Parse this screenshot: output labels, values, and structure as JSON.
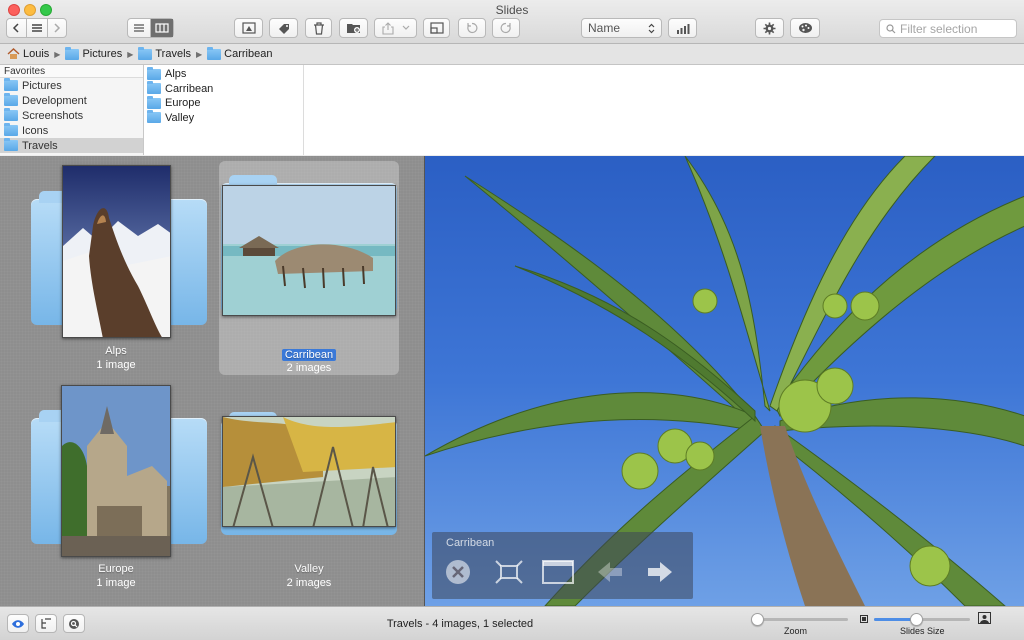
{
  "window": {
    "title": "Slides"
  },
  "toolbar": {
    "sort_value": "Name",
    "filter_placeholder": "Filter selection"
  },
  "path": [
    {
      "label": "Louis",
      "icon": "home-icon"
    },
    {
      "label": "Pictures",
      "icon": "folder-icon"
    },
    {
      "label": "Travels",
      "icon": "folder-icon"
    },
    {
      "label": "Carribean",
      "icon": "folder-icon"
    }
  ],
  "sidebar": {
    "header": "Favorites",
    "items": [
      {
        "label": "Pictures",
        "selected": false
      },
      {
        "label": "Development",
        "selected": false
      },
      {
        "label": "Screenshots",
        "selected": false
      },
      {
        "label": "Icons",
        "selected": false
      },
      {
        "label": "Travels",
        "selected": true
      }
    ]
  },
  "column": {
    "items": [
      "Alps",
      "Carribean",
      "Europe",
      "Valley"
    ]
  },
  "grid": {
    "items": [
      {
        "name": "Alps",
        "count": "1 image",
        "selected": false
      },
      {
        "name": "Carribean",
        "count": "2 images",
        "selected": true
      },
      {
        "name": "Europe",
        "count": "1 image",
        "selected": false
      },
      {
        "name": "Valley",
        "count": "2 images",
        "selected": false
      }
    ]
  },
  "hud": {
    "title": "Carribean"
  },
  "status": {
    "text": "Travels - 4 images, 1 selected"
  },
  "zoom": {
    "label": "Zoom",
    "value_fraction": 0.0
  },
  "slides_size": {
    "label": "Slides Size",
    "value_fraction": 0.43
  },
  "colors": {
    "accent": "#3a79d8",
    "folder": "#8ec6f3"
  }
}
